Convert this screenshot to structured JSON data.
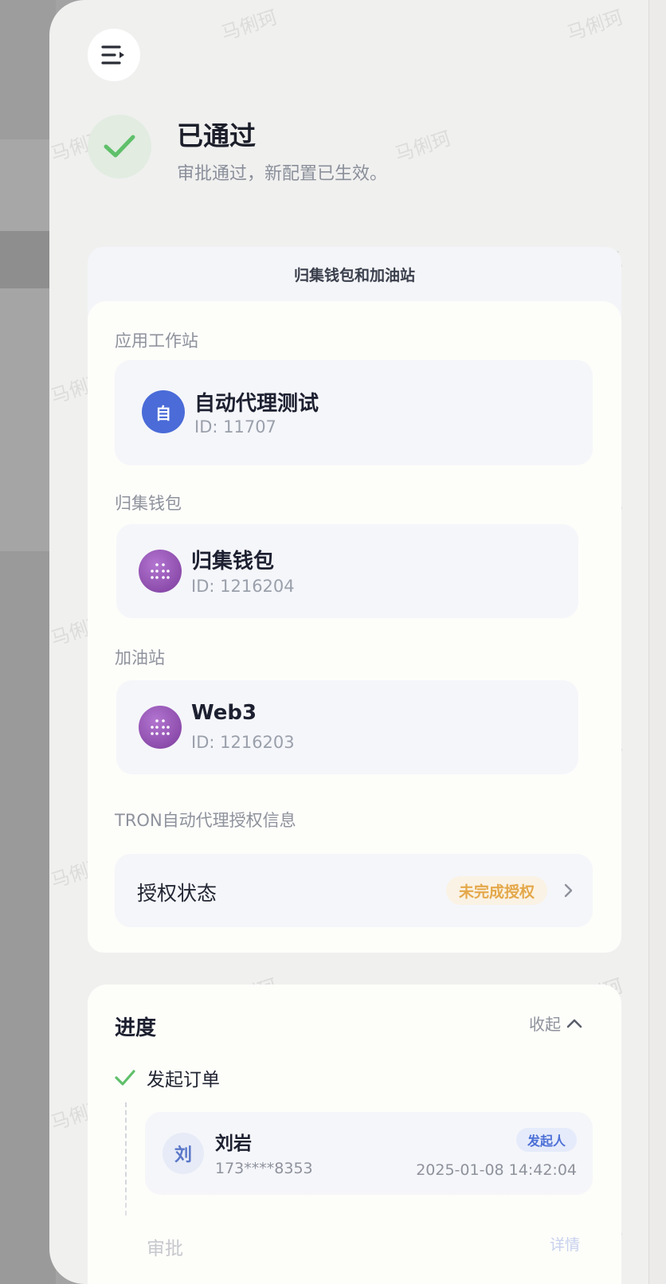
{
  "header": {
    "menu_icon": "menu-collapse-icon"
  },
  "status": {
    "icon": "check-icon",
    "title": "已通过",
    "subtitle": "审批通过，新配置已生效。",
    "color": "#5fc06a"
  },
  "section": {
    "title": "归集钱包和加油站",
    "groups": [
      {
        "label": "应用工作站",
        "name": "自动代理测试",
        "id": "ID: 11707",
        "avatar_text": "自",
        "avatar_color": "#4a6bd8"
      },
      {
        "label": "归集钱包",
        "name": "归集钱包",
        "id": "ID: 1216204",
        "avatar_icon": "dot-grid-icon",
        "avatar_color": "#9a4fbe"
      },
      {
        "label": "加油站",
        "name": "Web3",
        "id": "ID: 1216203",
        "avatar_icon": "dot-grid-icon",
        "avatar_color": "#9a4fbe"
      }
    ],
    "tron": {
      "label": "TRON自动代理授权信息",
      "row_label": "授权状态",
      "badge": "未完成授权",
      "badge_color": "#e4a84a"
    }
  },
  "progress": {
    "title": "进度",
    "collapse_label": "收起",
    "steps": [
      {
        "label": "发起订单",
        "person": {
          "avatar_text": "刘",
          "name": "刘岩",
          "phone": "173****8353",
          "role": "发起人",
          "time": "2025-01-08 14:42:04"
        }
      },
      {
        "label": "审批",
        "detail_label": "详情"
      }
    ]
  },
  "watermark_text": "马俐珂"
}
